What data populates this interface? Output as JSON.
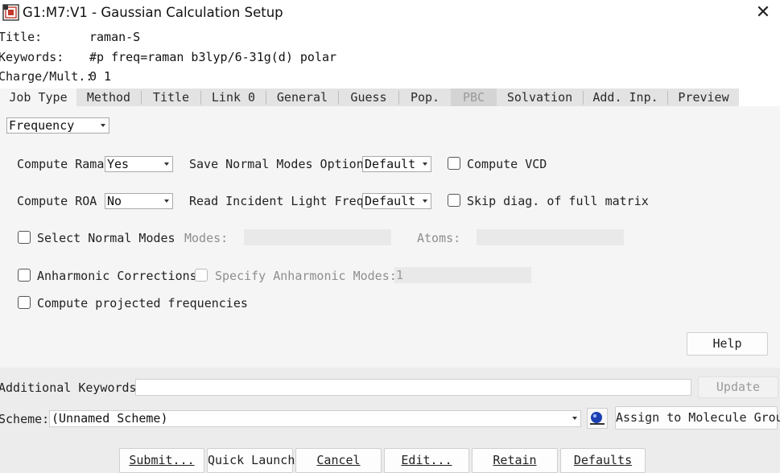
{
  "window": {
    "title": "G1:M7:V1 - Gaussian Calculation Setup",
    "close_glyph": "✕",
    "icon": "gaussian-app-icon"
  },
  "header": {
    "title_label": "Title:",
    "title_value": "raman-S",
    "keywords_label": "Keywords:",
    "keywords_value": "#p freq=raman b3lyp/6-31g(d) polar",
    "charge_label": "Charge/Mult.:",
    "charge_value": "0 1"
  },
  "tabs": [
    {
      "label": "Job Type",
      "selected": true,
      "disabled": false
    },
    {
      "label": "Method",
      "selected": false,
      "disabled": false
    },
    {
      "label": "Title",
      "selected": false,
      "disabled": false
    },
    {
      "label": "Link 0",
      "selected": false,
      "disabled": false
    },
    {
      "label": "General",
      "selected": false,
      "disabled": false
    },
    {
      "label": "Guess",
      "selected": false,
      "disabled": false
    },
    {
      "label": "Pop.",
      "selected": false,
      "disabled": false
    },
    {
      "label": "PBC",
      "selected": false,
      "disabled": true
    },
    {
      "label": "Solvation",
      "selected": false,
      "disabled": false
    },
    {
      "label": "Add. Inp.",
      "selected": false,
      "disabled": false
    },
    {
      "label": "Preview",
      "selected": false,
      "disabled": false
    }
  ],
  "job": {
    "job_type": "Frequency",
    "compute_raman_label": "Compute Raman",
    "compute_raman_value": "Yes",
    "save_normal_modes_label": "Save Normal Modes Options",
    "save_normal_modes_value": "Default",
    "compute_vcd_label": "Compute VCD",
    "compute_roa_label": "Compute ROA",
    "compute_roa_value": "No",
    "read_incident_label": "Read Incident Light Freqs",
    "read_incident_value": "Default",
    "skip_diag_label": "Skip diag. of full matrix",
    "select_normal_modes_label": "Select Normal Modes",
    "modes_label": "Modes:",
    "atoms_label": "Atoms:",
    "anharmonic_label": "Anharmonic Corrections",
    "specify_anharmonic_label": "Specify Anharmonic Modes:",
    "specify_anharmonic_value": "1",
    "projected_freq_label": "Compute projected frequencies",
    "help_label": "Help"
  },
  "footer": {
    "additional_keywords_label": "Additional Keywords:",
    "additional_keywords_value": "",
    "update_label": "Update",
    "scheme_label": "Scheme:",
    "scheme_value": "(Unnamed Scheme)",
    "assign_label": "Assign to Molecule Group",
    "buttons": {
      "submit": "Submit...",
      "quick_launch": "Quick Launch",
      "cancel": "Cancel",
      "edit": "Edit...",
      "retain": "Retain",
      "defaults": "Defaults"
    }
  },
  "colors": {
    "panel": "#f5f5f5",
    "footer": "#ececec",
    "tab_strip": "#e3e3e3"
  }
}
